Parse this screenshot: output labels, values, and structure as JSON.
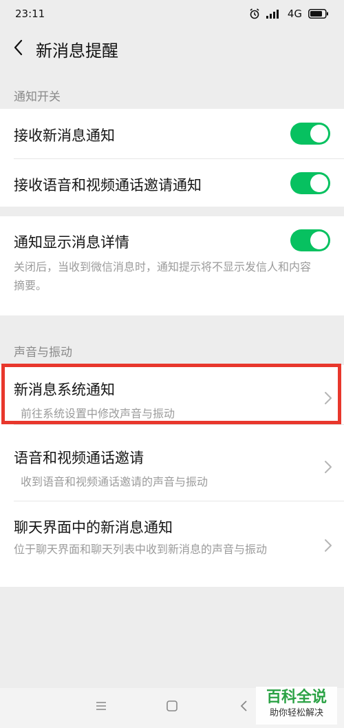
{
  "status_bar": {
    "time": "23:11",
    "network": "4G",
    "icons": [
      "alarm-icon",
      "signal-icon",
      "battery-icon"
    ]
  },
  "header": {
    "title": "新消息提醒",
    "back_icon": "chevron-left-icon"
  },
  "sections": {
    "notifications_label": "通知开关",
    "sound_label": "声音与振动"
  },
  "notification_switches": [
    {
      "title": "接收新消息通知",
      "enabled": true
    },
    {
      "title": "接收语音和视频通话邀请通知",
      "enabled": true
    }
  ],
  "detail_switch": {
    "title": "通知显示消息详情",
    "enabled": true,
    "description": "关闭后，当收到微信消息时，通知提示将不显示发信人和内容摘要。"
  },
  "sound_items": [
    {
      "title": "新消息系统通知",
      "description": "前往系统设置中修改声音与振动",
      "highlighted": true
    },
    {
      "title": "语音和视频通话邀请",
      "description": "收到语音和视频通话邀请的声音与振动"
    },
    {
      "title": "聊天界面中的新消息通知",
      "description": "位于聊天界面和聊天列表中收到新消息的声音与振动"
    }
  ],
  "nav_bar": {
    "icons": [
      "menu-icon",
      "home-icon",
      "back-icon"
    ]
  },
  "watermark": {
    "title": "百科全说",
    "subtitle": "助你轻松解决"
  },
  "colors": {
    "toggle_on": "#07c160",
    "highlight": "#e8372c",
    "watermark_green": "#2ba245"
  }
}
